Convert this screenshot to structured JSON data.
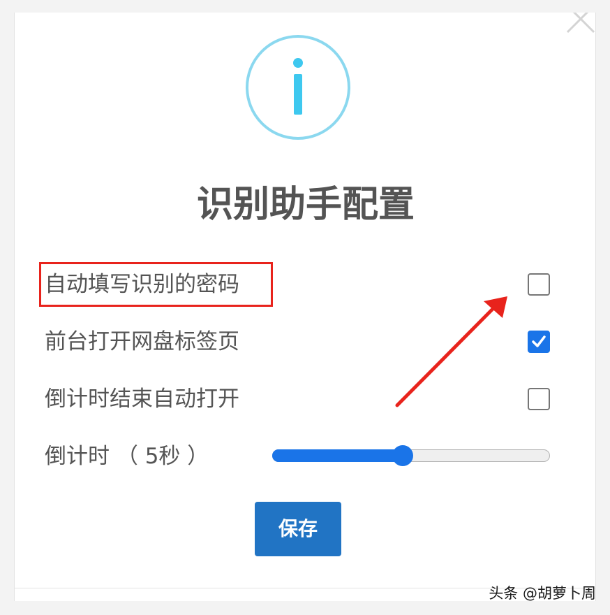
{
  "dialog": {
    "title": "识别助手配置",
    "options": [
      {
        "label": "自动填写识别的密码",
        "checked": false
      },
      {
        "label": "前台打开网盘标签页",
        "checked": true
      },
      {
        "label": "倒计时结束自动打开",
        "checked": false
      }
    ],
    "countdown": {
      "label": "倒计时 （ 5秒 ）",
      "seconds": 5,
      "slider_fraction": 0.47
    },
    "save_label": "保存"
  },
  "icons": {
    "close": "close-icon",
    "info": "info-icon",
    "check": "check-icon"
  },
  "annotation": {
    "highlight_color": "#e8231c",
    "arrow_color": "#e8231c"
  },
  "watermark": {
    "text": "头条 @胡萝卜周"
  },
  "colors": {
    "accent": "#1a74e8",
    "button": "#2174c4",
    "info_ring": "#8bd8ef",
    "info_glyph": "#3ec8ef"
  }
}
